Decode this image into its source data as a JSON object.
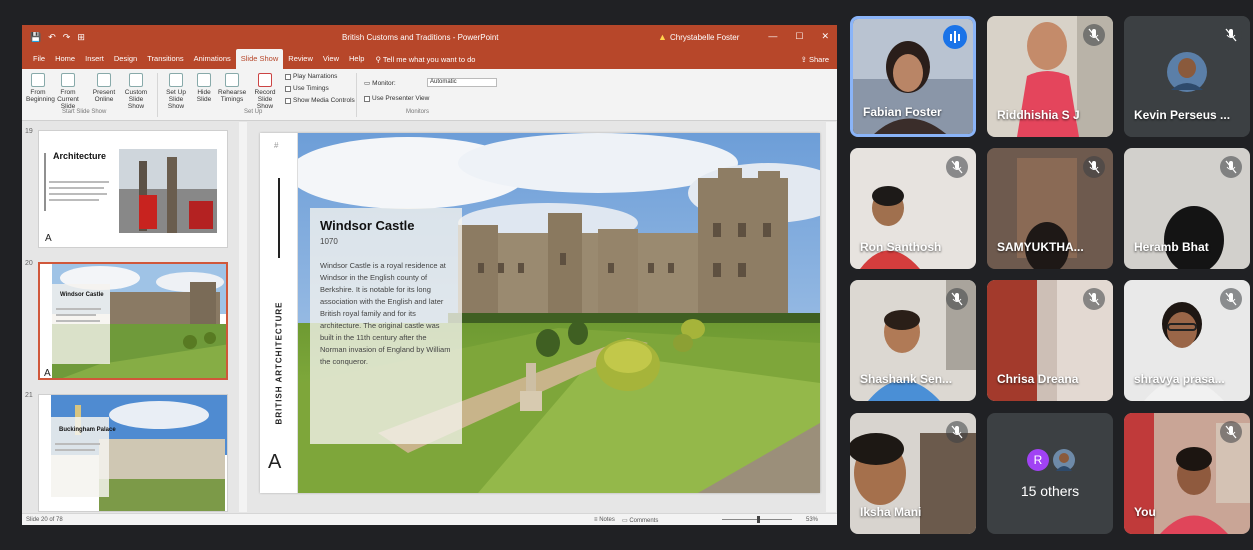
{
  "powerpoint": {
    "quick_access": [
      "💾",
      "↶",
      "↷",
      "⊞"
    ],
    "document_title": "British Customs and Traditions - PowerPoint",
    "user_name": "Chrystabelle Foster",
    "window_controls": [
      "—",
      "☐",
      "✕"
    ],
    "menu_tabs": [
      "File",
      "Home",
      "Insert",
      "Design",
      "Transitions",
      "Animations",
      "Slide Show",
      "Review",
      "View",
      "Help"
    ],
    "active_tab": "Slide Show",
    "tell_me": "Tell me what you want to do",
    "share": "Share",
    "ribbon": {
      "from_beginning": "From Beginning",
      "from_current": "From Current Slide",
      "present_online": "Present Online",
      "custom_slide_show": "Custom Slide Show",
      "group_start": "Start Slide Show",
      "set_up_slide_show": "Set Up Slide Show",
      "hide_slide": "Hide Slide",
      "rehearse_timings": "Rehearse Timings",
      "record_slide_show": "Record Slide Show",
      "play_narrations": "Play Narrations",
      "use_timings": "Use Timings",
      "show_media_controls": "Show Media Controls",
      "group_setup": "Set Up",
      "monitor_label": "Monitor:",
      "monitor_value": "Automatic",
      "use_presenter_view": "Use Presenter View",
      "group_monitors": "Monitors"
    },
    "thumbnails": [
      {
        "number": "19",
        "title": "Architecture"
      },
      {
        "number": "20",
        "title": "Windsor Castle"
      },
      {
        "number": "21",
        "title": "Buckingham Palace"
      }
    ],
    "slide": {
      "vertical_title": "BRITISH ARTCHITECTURE",
      "letter": "A",
      "heading": "Windsor Castle",
      "year": "1070",
      "body": "Windsor Castle is a royal residence at Windsor in the English county of Berkshire. It is notable for its long association with the English and later British royal family and for its architecture. The original castle was built in the 11th century after the Norman invasion of England by William the conqueror."
    },
    "status": {
      "slide_counter": "Slide 20 of 78",
      "notes": "Notes",
      "comments": "Comments",
      "zoom": "53%"
    }
  },
  "meet": {
    "participants": [
      {
        "name": "Fabian Foster",
        "speaking": true
      },
      {
        "name": "Riddhishia S J",
        "muted": true
      },
      {
        "name": "Kevin Perseus ...",
        "muted": true
      },
      {
        "name": "Ron Santhosh",
        "muted": true
      },
      {
        "name": "SAMYUKTHA...",
        "muted": true
      },
      {
        "name": "Heramb Bhat",
        "muted": true
      },
      {
        "name": "Shashank Sen...",
        "muted": true
      },
      {
        "name": "Chrisa Dreana",
        "muted": true
      },
      {
        "name": "shravya prasa...",
        "muted": true
      },
      {
        "name": "Iksha Mani",
        "muted": true
      },
      {
        "name": "15 others",
        "avatar_letter": "R"
      },
      {
        "name": "You",
        "muted": true
      }
    ],
    "colors": {
      "tile_bg": "#3c4043",
      "speaking_blue": "#1a73e8",
      "ppt_red": "#b7472a"
    }
  }
}
